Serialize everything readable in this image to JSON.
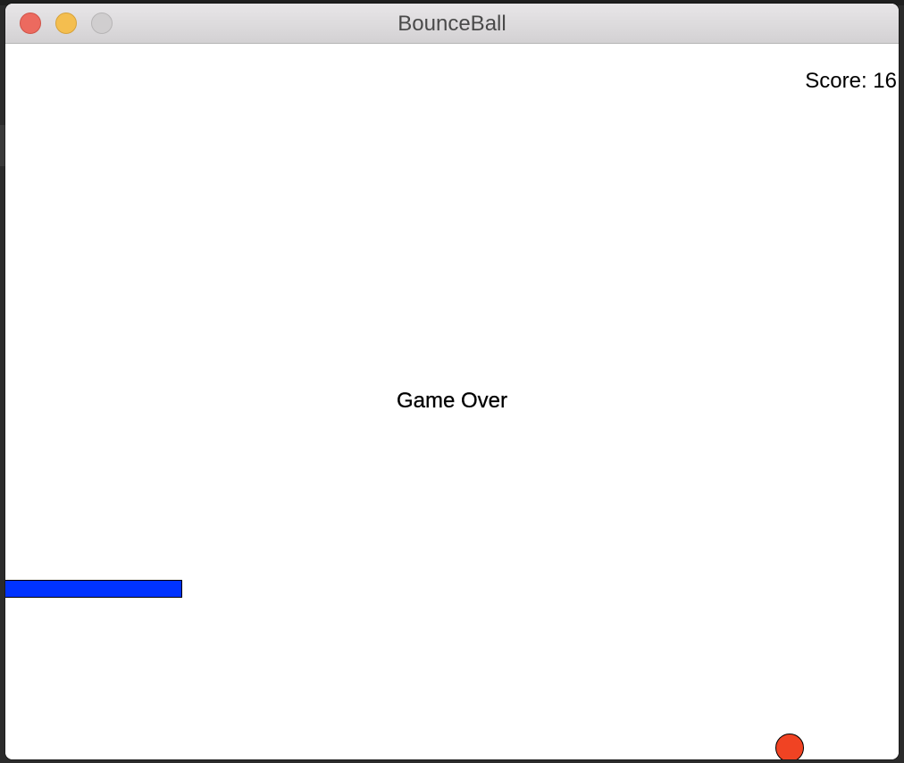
{
  "window": {
    "title": "BounceBall",
    "buttons": {
      "close_color": "#ec6a5f",
      "minimize_color": "#f4be4f",
      "zoom_color": "#d0cecf"
    }
  },
  "game": {
    "score_text": "Score: 16",
    "status_text": "Game Over",
    "paddle_color": "#0033ff",
    "ball_color": "#f04323",
    "background_color": "#ffffff"
  }
}
